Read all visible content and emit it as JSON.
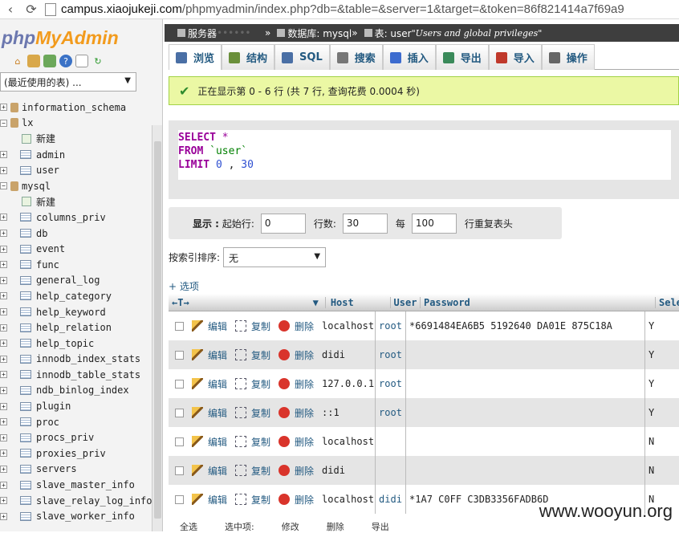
{
  "browser": {
    "url_host": "campus.xiaojukeji.com",
    "url_rest": "/phpmyadmin/index.php?db=&table=&server=1&target=&token=86f821414a7f69a9"
  },
  "sidebar": {
    "logo_php": "php",
    "logo_myadmin": "MyAdmin",
    "db_select": "(最近使用的表) ...",
    "tree": [
      {
        "kind": "db",
        "label": "information_schema"
      },
      {
        "kind": "db",
        "label": "lx"
      },
      {
        "kind": "new",
        "label": "新建"
      },
      {
        "kind": "table",
        "label": "admin"
      },
      {
        "kind": "table",
        "label": "user"
      },
      {
        "kind": "db",
        "label": "mysql"
      },
      {
        "kind": "new",
        "label": "新建"
      },
      {
        "kind": "table",
        "label": "columns_priv"
      },
      {
        "kind": "table",
        "label": "db"
      },
      {
        "kind": "table",
        "label": "event"
      },
      {
        "kind": "table",
        "label": "func"
      },
      {
        "kind": "table",
        "label": "general_log"
      },
      {
        "kind": "table",
        "label": "help_category"
      },
      {
        "kind": "table",
        "label": "help_keyword"
      },
      {
        "kind": "table",
        "label": "help_relation"
      },
      {
        "kind": "table",
        "label": "help_topic"
      },
      {
        "kind": "table",
        "label": "innodb_index_stats"
      },
      {
        "kind": "table",
        "label": "innodb_table_stats"
      },
      {
        "kind": "table",
        "label": "ndb_binlog_index"
      },
      {
        "kind": "table",
        "label": "plugin"
      },
      {
        "kind": "table",
        "label": "proc"
      },
      {
        "kind": "table",
        "label": "procs_priv"
      },
      {
        "kind": "table",
        "label": "proxies_priv"
      },
      {
        "kind": "table",
        "label": "servers"
      },
      {
        "kind": "table",
        "label": "slave_master_info"
      },
      {
        "kind": "table",
        "label": "slave_relay_log_info"
      },
      {
        "kind": "table",
        "label": "slave_worker_info"
      }
    ]
  },
  "breadcrumb": {
    "server": "服务器",
    "database": "数据库: mysql",
    "table_prefix": "表: user",
    "table_comment": "\"Users and global privileges\""
  },
  "tabs": [
    {
      "label": "浏览",
      "color": "#4a6fa5",
      "active": true
    },
    {
      "label": "结构",
      "color": "#6a8f3a",
      "active": false
    },
    {
      "label": "SQL",
      "color": "#4a6fa5",
      "active": false
    },
    {
      "label": "搜索",
      "color": "#777777",
      "active": false
    },
    {
      "label": "插入",
      "color": "#3d6ccf",
      "active": false
    },
    {
      "label": "导出",
      "color": "#3a8a5a",
      "active": false
    },
    {
      "label": "导入",
      "color": "#c0392b",
      "active": false
    },
    {
      "label": "操作",
      "color": "#666666",
      "active": false
    }
  ],
  "success": {
    "message": "正在显示第 0 - 6 行 (共 7 行, 查询花费 0.0004 秒)"
  },
  "sql": {
    "select": "SELECT",
    "star": "*",
    "from": "FROM",
    "table": "`user`",
    "limit": "LIMIT",
    "offset": "0",
    "comma": ",",
    "count": "30"
  },
  "navigation": {
    "show_label": "显示 :",
    "start_label": "起始行:",
    "start_value": "0",
    "rows_label": "行数:",
    "rows_value": "30",
    "every_label": "每",
    "every_value": "100",
    "repeat_label": "行重复表头"
  },
  "sort": {
    "label": "按索引排序:",
    "value": "无"
  },
  "options_link": "+ 选项",
  "grid": {
    "arrows": "←T→",
    "columns": {
      "host": "Host",
      "user": "User",
      "password": "Password",
      "select": "Sele"
    },
    "actions": {
      "edit": "编辑",
      "copy": "复制",
      "delete": "删除"
    },
    "rows": [
      {
        "host": "localhost",
        "user": "root",
        "password": "*6691484EA6B5     5192640    DA01E    875C18A",
        "select": "Y"
      },
      {
        "host": "didi",
        "user": "root",
        "password": "",
        "select": "Y"
      },
      {
        "host": "127.0.0.1",
        "user": "root",
        "password": "",
        "select": "Y"
      },
      {
        "host": "::1",
        "user": "root",
        "password": "",
        "select": "Y"
      },
      {
        "host": "localhost",
        "user": "",
        "password": "",
        "select": "N"
      },
      {
        "host": "didi",
        "user": "",
        "password": "",
        "select": "N"
      },
      {
        "host": "localhost",
        "user": "didi",
        "password": "*1A7          C0FF    C3DB3356FADB6D",
        "select": "N"
      }
    ]
  },
  "bottom_bar": [
    "全选",
    "选中项:",
    "修改",
    "删除",
    "导出"
  ],
  "watermark": "www.wooyun.org"
}
